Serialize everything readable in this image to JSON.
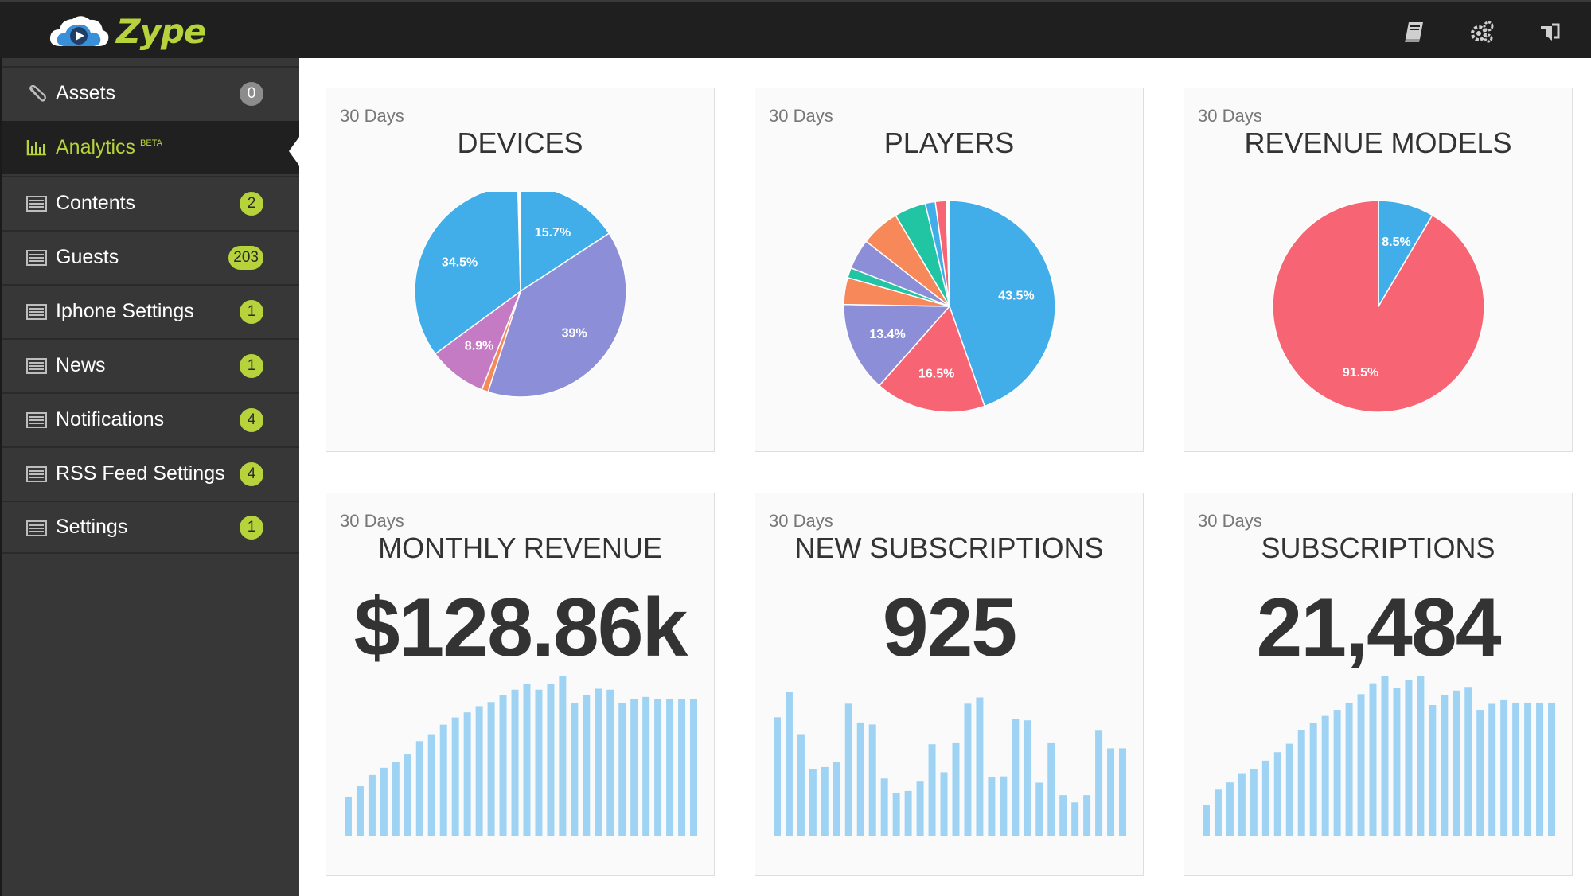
{
  "app": {
    "name": "Zype",
    "colors": {
      "brand": "#b6d33c",
      "topbar": "#1f1f1f",
      "sidebar": "#373737"
    }
  },
  "topbar": {
    "icons": [
      "book-icon",
      "gears-icon",
      "signout-icon"
    ]
  },
  "sidebar": {
    "items": [
      {
        "label": "Assets",
        "badge": "0",
        "icon": "paperclip-icon"
      },
      {
        "label": "Analytics",
        "tag": "BETA",
        "icon": "bar-chart-icon",
        "active": true
      },
      {
        "label": "Contents",
        "badge": "2",
        "icon": "list-icon"
      },
      {
        "label": "Guests",
        "badge": "203",
        "icon": "list-icon"
      },
      {
        "label": "Iphone Settings",
        "badge": "1",
        "icon": "list-icon"
      },
      {
        "label": "News",
        "badge": "1",
        "icon": "list-icon"
      },
      {
        "label": "Notifications",
        "badge": "4",
        "icon": "list-icon"
      },
      {
        "label": "RSS Feed Settings",
        "badge": "4",
        "icon": "list-icon"
      },
      {
        "label": "Settings",
        "badge": "1",
        "icon": "list-icon"
      }
    ]
  },
  "cards": {
    "devices": {
      "period": "30 Days",
      "title": "DEVICES"
    },
    "players": {
      "period": "30 Days",
      "title": "PLAYERS"
    },
    "revenue_models": {
      "period": "30 Days",
      "title": "REVENUE MODELS"
    },
    "monthly_revenue": {
      "period": "30 Days",
      "title": "MONTHLY REVENUE",
      "value": "$128.86k"
    },
    "new_subscriptions": {
      "period": "30 Days",
      "title": "NEW SUBSCRIPTIONS",
      "value": "925"
    },
    "subscriptions": {
      "period": "30 Days",
      "title": "SUBSCRIPTIONS",
      "value": "21,484"
    }
  },
  "chart_data": [
    {
      "id": "devices",
      "type": "pie",
      "slices": [
        {
          "value": 15.7,
          "label": "15.7%",
          "color": "#41aeea"
        },
        {
          "value": 39.0,
          "label": "39%",
          "color": "#8c8fd8"
        },
        {
          "value": 1.0,
          "label": "",
          "color": "#f6885a"
        },
        {
          "value": 8.9,
          "label": "8.9%",
          "color": "#c57bc4"
        },
        {
          "value": 34.5,
          "label": "34.5%",
          "color": "#41aeea"
        },
        {
          "value": 0.4,
          "label": "",
          "color": "#ffffff"
        }
      ]
    },
    {
      "id": "players",
      "type": "pie",
      "slices": [
        {
          "value": 43.5,
          "label": "43.5%",
          "color": "#41aeea"
        },
        {
          "value": 16.5,
          "label": "16.5%",
          "color": "#f76575"
        },
        {
          "value": 13.4,
          "label": "13.4%",
          "color": "#8c8fd8"
        },
        {
          "value": 4.0,
          "label": "",
          "color": "#f6885a"
        },
        {
          "value": 1.5,
          "label": "",
          "color": "#21c4a3"
        },
        {
          "value": 4.5,
          "label": "",
          "color": "#8c8fd8"
        },
        {
          "value": 5.8,
          "label": "",
          "color": "#f6885a"
        },
        {
          "value": 4.7,
          "label": "",
          "color": "#21c4a3"
        },
        {
          "value": 1.5,
          "label": "",
          "color": "#41aeea"
        },
        {
          "value": 1.6,
          "label": "",
          "color": "#f76575"
        },
        {
          "value": 0.5,
          "label": "",
          "color": "#ffffff"
        }
      ]
    },
    {
      "id": "revenue_models",
      "type": "pie",
      "slices": [
        {
          "value": 8.5,
          "label": "8.5%",
          "color": "#41aeea"
        },
        {
          "value": 91.5,
          "label": "91.5%",
          "color": "#f76575"
        }
      ]
    },
    {
      "id": "monthly_revenue",
      "type": "bar",
      "color": "#9fd3f4",
      "values": [
        38,
        48,
        59,
        66,
        72,
        79,
        92,
        98,
        108,
        115,
        120,
        126,
        130,
        137,
        142,
        148,
        142,
        148,
        155,
        129,
        137,
        143,
        142,
        129,
        133,
        135,
        133,
        133,
        133,
        133
      ]
    },
    {
      "id": "new_subscriptions",
      "type": "bar",
      "color": "#9fd3f4",
      "values": [
        114,
        138,
        97,
        64,
        66,
        71,
        127,
        109,
        107,
        55,
        41,
        43,
        52,
        88,
        61,
        89,
        127,
        133,
        56,
        57,
        112,
        111,
        51,
        89,
        39,
        32,
        39,
        101,
        84,
        84
      ]
    },
    {
      "id": "subscriptions",
      "type": "bar",
      "color": "#9fd3f4",
      "values": [
        25,
        38,
        44,
        51,
        55,
        62,
        69,
        76,
        87,
        93,
        99,
        104,
        110,
        117,
        126,
        133,
        122,
        129,
        135,
        108,
        116,
        120,
        123,
        104,
        109,
        112,
        110,
        110,
        110,
        110
      ]
    }
  ]
}
